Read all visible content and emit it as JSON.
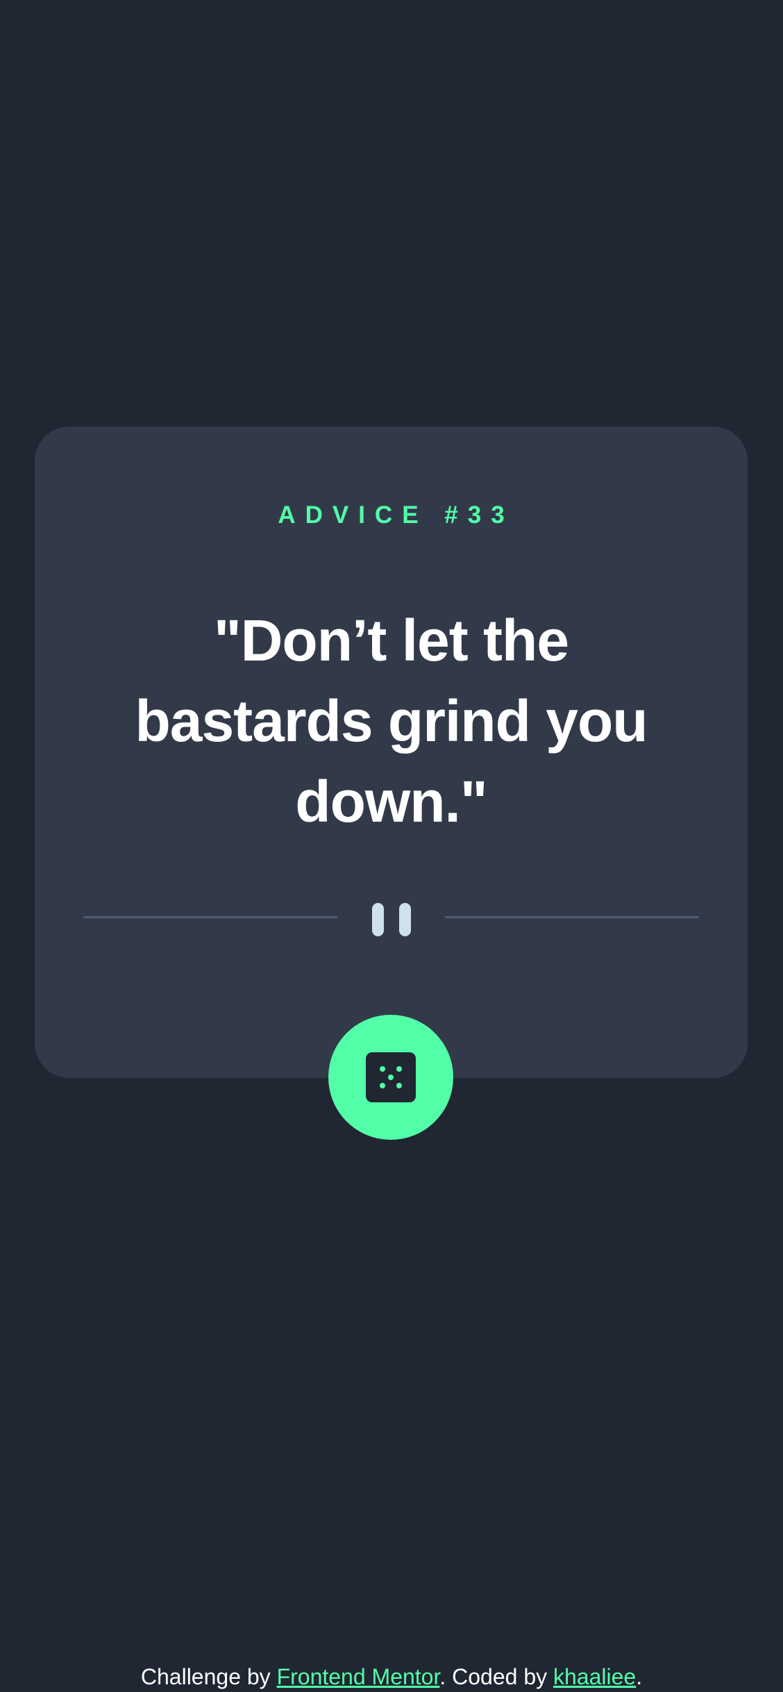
{
  "card": {
    "advice_label": "ADVICE #33",
    "quote": "\"Don’t let the bastards grind you down.\""
  },
  "divider": {
    "icon": "pause-icon"
  },
  "dice_button": {
    "icon": "dice-icon"
  },
  "footer": {
    "prefix": "Challenge by ",
    "frontend_mentor_link": "Frontend Mentor",
    "middle": ". Coded by ",
    "author_link": "khaaliee",
    "suffix": "."
  },
  "colors": {
    "background": "#202632",
    "card": "#323a4a",
    "accent": "#52ffa8",
    "divider": "#4e5d73",
    "pause": "#cee3e9",
    "text": "#ffffff"
  }
}
